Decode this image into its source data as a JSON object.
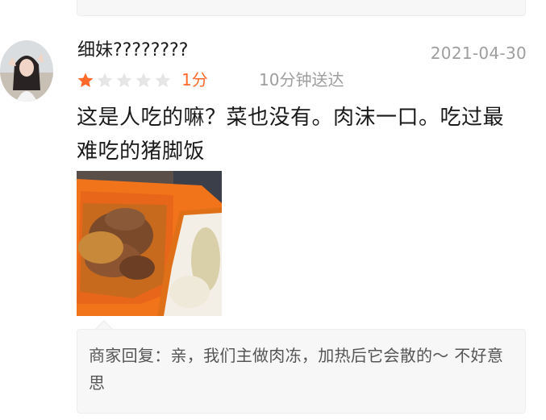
{
  "review": {
    "username": "细妹????????",
    "date": "2021-04-30",
    "rating": 1,
    "rating_max": 5,
    "score_label": "1分",
    "delivery_time": "10分钟送达",
    "content": "这是人吃的嘛？菜也没有。肉沫一口。吃过最难吃的猪脚饭",
    "photo": "pork-trotter-rice-photo"
  },
  "merchant_reply": {
    "text": "商家回复：亲，我们主做肉冻，加热后它会散的～ 不好意思"
  },
  "colors": {
    "star_active": "#ff6a2b",
    "star_inactive": "#e6e6e6",
    "score": "#ff6a2b",
    "meta": "#9e9e9e"
  }
}
